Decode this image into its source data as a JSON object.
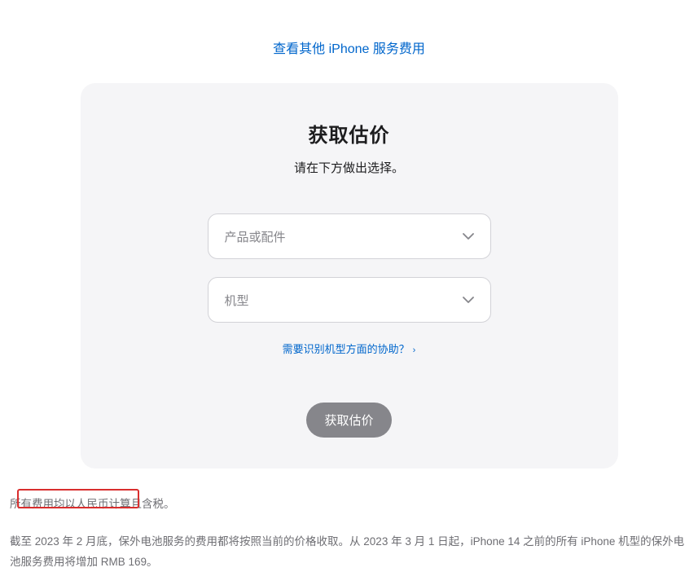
{
  "topLink": {
    "text": "查看其他 iPhone 服务费用"
  },
  "card": {
    "title": "获取估价",
    "subtitle": "请在下方做出选择。",
    "select1": {
      "placeholder": "产品或配件"
    },
    "select2": {
      "placeholder": "机型"
    },
    "helpLink": {
      "text": "需要识别机型方面的协助？"
    },
    "submitButton": {
      "label": "获取估价"
    }
  },
  "footer": {
    "line1": "所有费用均以人民币计算且含税。",
    "line2": "截至 2023 年 2 月底，保外电池服务的费用都将按照当前的价格收取。从 2023 年 3 月 1 日起，iPhone 14 之前的所有 iPhone 机型的保外电池服务费用将增加 RMB 169。"
  }
}
